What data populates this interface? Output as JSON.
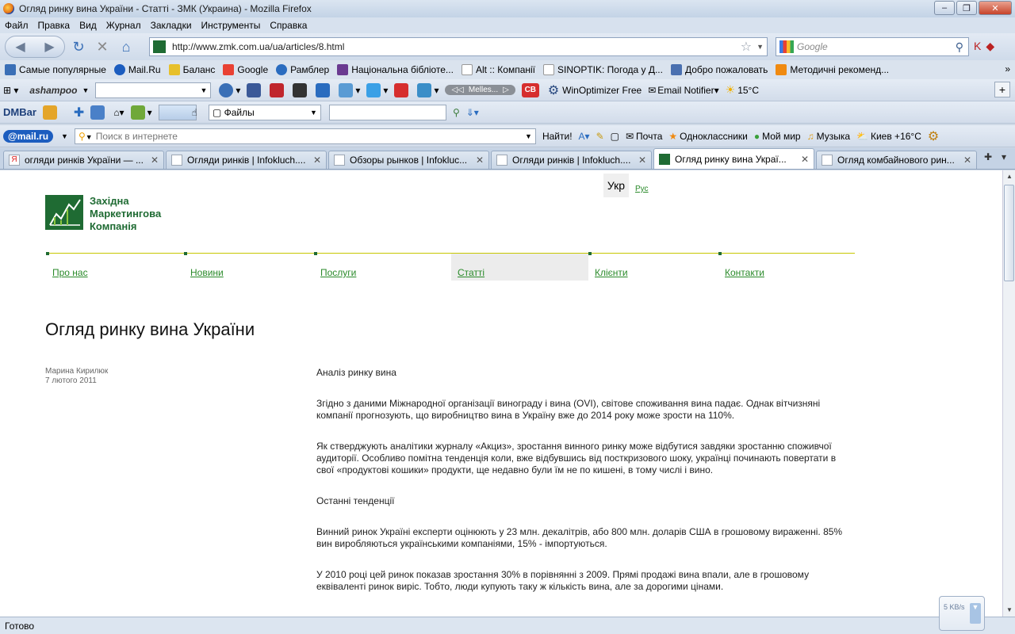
{
  "window": {
    "title": "Огляд ринку вина України - Статті - ЗМК (Украина) - Mozilla Firefox"
  },
  "menubar": [
    "Файл",
    "Правка",
    "Вид",
    "Журнал",
    "Закладки",
    "Инструменты",
    "Справка"
  ],
  "nav": {
    "url": "http://www.zmk.com.ua/ua/articles/8.html",
    "search_placeholder": "Google"
  },
  "bookmarks": [
    {
      "label": "Самые популярные",
      "color": "#3a6fb6"
    },
    {
      "label": "Mail.Ru",
      "color": "#1c5dbf"
    },
    {
      "label": "Баланс",
      "color": "#e7c02b"
    },
    {
      "label": "Google",
      "color": "#e94133"
    },
    {
      "label": "Рамблер",
      "color": "#2a6cbf"
    },
    {
      "label": "Національна бібліоте...",
      "color": "#6a3a90"
    },
    {
      "label": "Alt :: Компанії",
      "color": "#ffffff"
    },
    {
      "label": "SINOPTIK: Погода у Д...",
      "color": "#ffffff"
    },
    {
      "label": "Добро пожаловать",
      "color": "#4a70b0"
    },
    {
      "label": "Методичні рекоменд...",
      "color": "#f08a10"
    }
  ],
  "toolbar1": {
    "brand": "ashampoo",
    "winoptimizer": "WinOptimizer Free",
    "email": "Email Notifier",
    "weather": "15°C",
    "player": "Melles..."
  },
  "toolbar2": {
    "dmbar": "DMBar",
    "files": "Файлы"
  },
  "toolbar3": {
    "mailru": "@mail.ru",
    "search_placeholder": "Поиск в интернете",
    "find": "Найти!",
    "mail": "Почта",
    "ok": "Одноклассники",
    "myworld": "Мой мир",
    "music": "Музыка",
    "weather": "Киев +16°C"
  },
  "tabs": [
    {
      "label": "огляди ринків України — ...",
      "active": false
    },
    {
      "label": "Огляди ринків | Infokluch....",
      "active": false
    },
    {
      "label": "Обзоры рынков | Infokluc...",
      "active": false
    },
    {
      "label": "Огляди ринків | Infokluch....",
      "active": false
    },
    {
      "label": "Огляд ринку вина Украї...",
      "active": true
    },
    {
      "label": "Огляд комбайнового рин...",
      "active": false
    }
  ],
  "page": {
    "logo": [
      "Західна",
      "Маркетингова",
      "Компанія"
    ],
    "lang_active": "Укр",
    "lang_other": "Рус",
    "menu": [
      {
        "label": "Про нас",
        "active": false
      },
      {
        "label": "Новини",
        "active": false
      },
      {
        "label": "Послуги",
        "active": false
      },
      {
        "label": "Статті",
        "active": true
      },
      {
        "label": "Клієнти",
        "active": false
      },
      {
        "label": "Контакти",
        "active": false
      }
    ],
    "title": "Огляд ринку вина України",
    "author": "Марина Кирилюк",
    "date": "7 лютого 2011",
    "paragraphs": [
      "Аналіз ринку вина",
      "Згідно з даними Міжнародної організації винограду і вина (OVI), світове споживання вина падає. Однак вітчизняні компанії прогнозують, що виробництво вина в Україну вже до 2014 року може зрости на 110%.",
      "Як стверджують аналітики журналу «Акциз», зростання винного ринку може відбутися завдяки зростанню споживчої аудиторії. Особливо помітна тенденція коли, вже відбувшись від посткризового шоку, українці починають повертати в свої «продуктові кошики» продукти, ще недавно були їм не по кишені, в тому числі і вино.",
      "Останні тенденції",
      "Винний ринок Україні експерти оцінюють у 23 млн. декалітрів, або 800 млн. доларів США в грошовому вираженні. 85% вин виробляються українськими компаніями, 15% - імпортуються.",
      "У 2010 році цей ринок показав зростання 30% в порівнянні з 2009. Прямі продажі вина впали, але в грошовому еквіваленті ринок виріс. Тобто, люди купують таку ж кількість вина, але за дорогими цінами."
    ]
  },
  "status": {
    "text": "Готово",
    "speed": "5 KB/s"
  }
}
